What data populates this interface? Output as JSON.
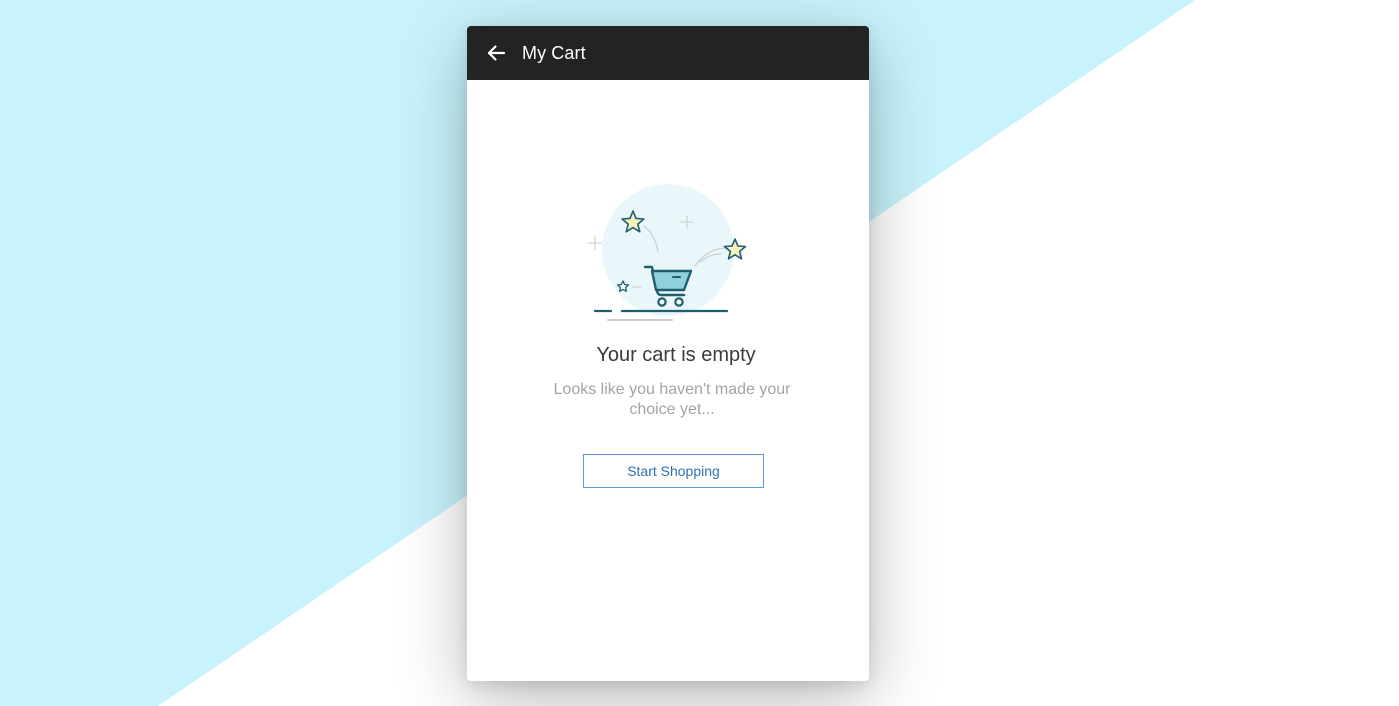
{
  "appbar": {
    "title": "My Cart",
    "back_icon": "arrow-left-icon"
  },
  "empty_state": {
    "illustration_icon": "shopping-cart-icon",
    "title": "Your cart is empty",
    "subtitle": "Looks like you haven't made your choice yet...",
    "button_label": "Start Shopping"
  },
  "colors": {
    "background_cyan": "#c8f3fc",
    "appbar": "#232323",
    "button_border": "#5b9bd5",
    "button_text": "#2f6fb4",
    "illustration_stroke": "#1e5f6e",
    "illustration_circle": "#eaf7fa",
    "star_fill": "#f6f1bd"
  }
}
